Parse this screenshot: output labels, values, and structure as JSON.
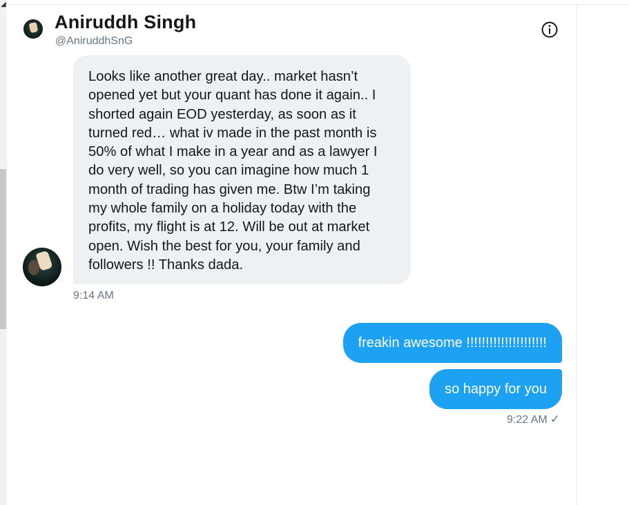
{
  "conversation": {
    "name": "Aniruddh Singh",
    "handle": "@AniruddhSnG"
  },
  "messages": {
    "received": {
      "text": "Looks like another great day.. market hasn’t\nopened yet but your quant has done it again.. I\nshorted again EOD yesterday, as soon as it\nturned red… what iv made in the past month is\n50% of what I make in a year and as a lawyer I\ndo very well, so you can imagine how much 1\nmonth of trading has given me. Btw I’m taking\nmy whole family on a holiday today with the\nprofits, my flight is at 12. Will be out at market\nopen. Wish the best for you, your family and\nfollowers !! Thanks dada.",
      "time": "9:14 AM"
    },
    "sent": [
      {
        "text": "freakin awesome !!!!!!!!!!!!!!!!!!!!!"
      },
      {
        "text": "so happy for you"
      }
    ],
    "sent_time": "9:22 AM",
    "sent_status_icon": "checkmark-icon"
  },
  "icons": {
    "info": "info-icon"
  },
  "colors": {
    "accent": "#1da1f2",
    "received_bubble": "#eef1f3",
    "secondary_text": "#657786"
  }
}
